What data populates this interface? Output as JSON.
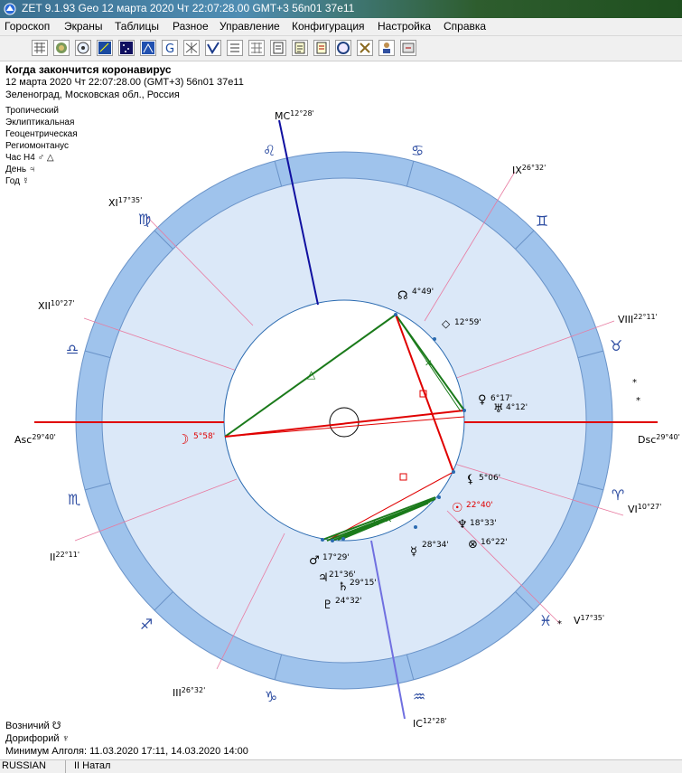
{
  "window": {
    "title": "ZET 9.1.93 Geo   12 марта 2020  Чт  22:07:28.00 GMT+3 56n01  37e11"
  },
  "menu": [
    "Гороскоп",
    "Экраны",
    "Таблицы",
    "Разное",
    "Управление",
    "Конфигурация",
    "Настройка",
    "Справка"
  ],
  "toolbar": [
    "table-icon",
    "globe-icon",
    "radix-icon",
    "aspect-grid-icon",
    "stars-icon",
    "chart-icon",
    "g-icon",
    "strings-icon",
    "check-icon",
    "list-icon",
    "grid-icon",
    "page-icon",
    "doc-icon",
    "circle-icon",
    "tools-icon",
    "person-icon",
    "export-icon"
  ],
  "header": {
    "title": "Когда закончится коронавирус",
    "datetime": "12 марта 2020  Чт  22:07:28.00 (GMT+3) 56n01  37e11",
    "place": "Зеленоград, Московская обл., Россия"
  },
  "info": {
    "lines": [
      "Тропический",
      "Эклиптикальная",
      "Геоцентрическая",
      "Региомонтанус"
    ],
    "hour_label": "Час H4",
    "hour_symbols": "♂ △",
    "day_label": "День",
    "day_symbol": "♃",
    "year_label": "Год",
    "year_symbol": "☿"
  },
  "chart": {
    "signs": [
      "♌",
      "♋",
      "♊",
      "♉",
      "♈",
      "♓",
      "♒",
      "♑",
      "♐",
      "♏",
      "♎",
      "♍"
    ],
    "axes": {
      "mc": "MC",
      "mc_deg": "12°28'",
      "ic": "IC",
      "ic_deg": "12°28'",
      "asc": "Asc",
      "asc_deg": "29°40'",
      "dsc": "Dsc",
      "dsc_deg": "29°40'"
    },
    "cusps": [
      {
        "num": "XI",
        "deg": "17°35'"
      },
      {
        "num": "XII",
        "deg": "10°27'"
      },
      {
        "num": "II",
        "deg": "22°11'"
      },
      {
        "num": "III",
        "deg": "26°32'"
      },
      {
        "num": "V",
        "deg": "17°35'"
      },
      {
        "num": "VI",
        "deg": "10°27'"
      },
      {
        "num": "VIII",
        "deg": "22°11'"
      },
      {
        "num": "IX",
        "deg": "26°32'"
      }
    ],
    "planets": [
      {
        "sym": "☊",
        "deg": "4°49'"
      },
      {
        "sym": "◇",
        "deg": "12°59'"
      },
      {
        "sym": "♀",
        "deg": "6°17'"
      },
      {
        "sym": "♅",
        "deg": "4°12'"
      },
      {
        "sym": "☽",
        "deg": "5°58'"
      },
      {
        "sym": "⚸",
        "deg": "5°06'"
      },
      {
        "sym": "☉",
        "deg": "22°40'"
      },
      {
        "sym": "♆",
        "deg": "18°33'"
      },
      {
        "sym": "⊗",
        "deg": "16°22'"
      },
      {
        "sym": "☿",
        "deg": "28°34'"
      },
      {
        "sym": "♂",
        "deg": "17°29'"
      },
      {
        "sym": "♃",
        "deg": "21°36'"
      },
      {
        "sym": "♄",
        "deg": "29°15'"
      },
      {
        "sym": "♇",
        "deg": "24°32'"
      }
    ]
  },
  "bottom": {
    "node_label": "Возничий",
    "node_sym": "☋",
    "dory_label": "Дорифорий",
    "dory_sym": "♆",
    "algol": "Минимум Алголя: 11.03.2020 17:11,  14.03.2020 14:00"
  },
  "status": {
    "lang": "RUSSIAN",
    "mode": "II Натал"
  },
  "colors": {
    "ring": "#9fc3ec",
    "ring_inner_fill": "#dbe8f8",
    "red": "#e00000",
    "green": "#1a7a1a",
    "blue": "#1010a0"
  }
}
